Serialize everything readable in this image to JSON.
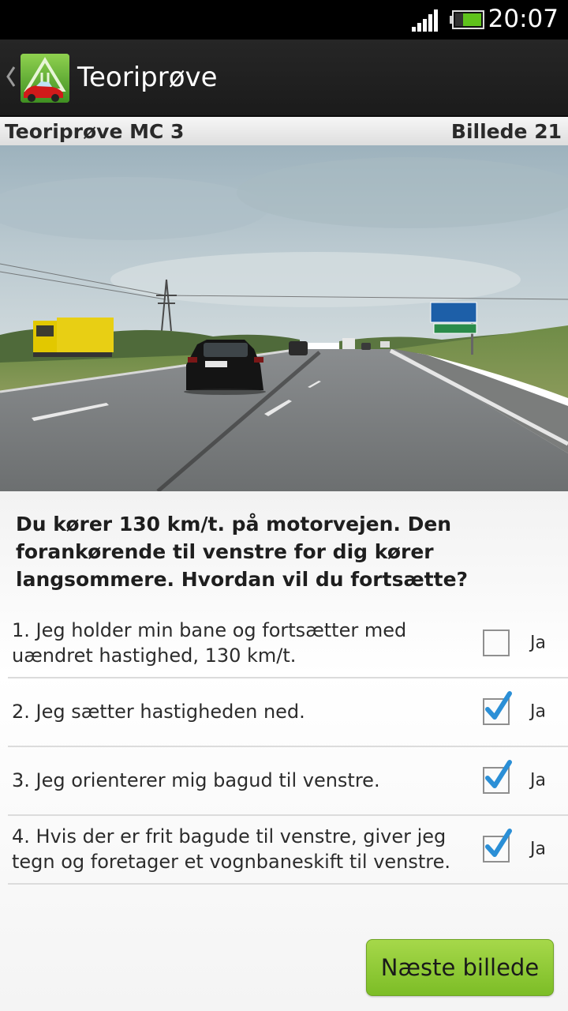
{
  "status_bar": {
    "time": "20:07"
  },
  "action_bar": {
    "title": "Teoriprøve"
  },
  "subheader": {
    "test_name": "Teoriprøve MC 3",
    "image_label": "Billede 21"
  },
  "question": {
    "text": "Du kører 130 km/t. på motorvejen. Den forankørende til venstre for dig kører langsommere. Hvordan vil du fortsætte?"
  },
  "answers": [
    {
      "text": "1. Jeg holder min bane og fortsætter med uændret hastighed, 130 km/t.",
      "checked": false,
      "label": "Ja"
    },
    {
      "text": "2. Jeg sætter hastigheden ned.",
      "checked": true,
      "label": "Ja"
    },
    {
      "text": "3. Jeg orienterer mig bagud til venstre.",
      "checked": true,
      "label": "Ja"
    },
    {
      "text": "4. Hvis der er frit bagude til venstre, giver jeg tegn og foretager et vognbaneskift til venstre.",
      "checked": true,
      "label": "Ja"
    }
  ],
  "next_button": {
    "label": "Næste billede"
  },
  "icons": {
    "signal": "signal-icon",
    "battery": "battery-icon",
    "back": "back-chevron-icon",
    "logo": "app-logo-icon",
    "check": "checkmark-icon"
  },
  "colors": {
    "accent_green": "#8cc83a",
    "check_blue": "#2b8fd6"
  }
}
